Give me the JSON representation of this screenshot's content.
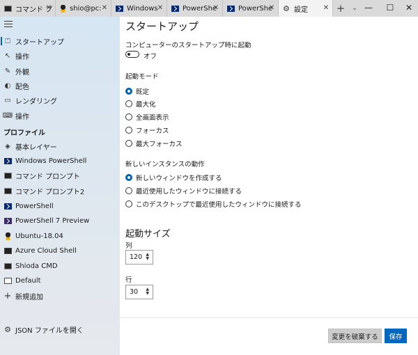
{
  "tabs": [
    {
      "label": "コマンド プ",
      "icon": "cmd-icon"
    },
    {
      "label": "shio@pc:",
      "icon": "linux-penguin-icon"
    },
    {
      "label": "Windows",
      "icon": "powershell-icon"
    },
    {
      "label": "PowerShe",
      "icon": "powershell-icon"
    },
    {
      "label": "PowerShe",
      "icon": "powershell-icon"
    },
    {
      "label": "設定",
      "icon": "gear-icon",
      "active": true
    }
  ],
  "tab_close_glyph": "✕",
  "new_tab_glyph": "+",
  "tab_dropdown_glyph": "⌄",
  "window": {
    "minimize": "—",
    "maximize": "☐",
    "close": "✕"
  },
  "sidebar": {
    "top_items": [
      {
        "label": "スタートアップ",
        "icon": "startup-icon",
        "selected": true
      },
      {
        "label": "操作",
        "icon": "interaction-icon"
      },
      {
        "label": "外観",
        "icon": "appearance-icon"
      },
      {
        "label": "配色",
        "icon": "color-palette-icon"
      },
      {
        "label": "レンダリング",
        "icon": "rendering-icon"
      },
      {
        "label": "操作",
        "icon": "actions-icon"
      }
    ],
    "profiles_header": "プロファイル",
    "profiles": [
      {
        "label": "基本レイヤー",
        "icon": "layers-icon"
      },
      {
        "label": "Windows PowerShell",
        "icon": "powershell-icon"
      },
      {
        "label": "コマンド プロンプト",
        "icon": "cmd-icon"
      },
      {
        "label": "コマンド プロンプト2",
        "icon": "cmd-icon"
      },
      {
        "label": "PowerShell",
        "icon": "powershell-icon"
      },
      {
        "label": "PowerShell 7 Preview",
        "icon": "powershell-preview-icon"
      },
      {
        "label": "Ubuntu-18.04",
        "icon": "linux-penguin-icon"
      },
      {
        "label": "Azure Cloud Shell",
        "icon": "azure-icon"
      },
      {
        "label": "Shioda CMD",
        "icon": "cmd-icon"
      },
      {
        "label": "Default",
        "icon": "terminal-icon"
      },
      {
        "label": "新規追加",
        "icon": "add-icon"
      }
    ],
    "open_json": "JSON ファイルを開く"
  },
  "main": {
    "title": "スタートアップ",
    "launch_on_startup_label": "コンピューターのスタートアップ時に起動",
    "launch_on_startup_state": "オフ",
    "launch_mode_label": "起動モード",
    "launch_modes": [
      "既定",
      "最大化",
      "全画面表示",
      "フォーカス",
      "最大フォーカス"
    ],
    "launch_mode_selected": 0,
    "new_instance_label": "新しいインスタンスの動作",
    "new_instance_options": [
      "新しいウィンドウを作成する",
      "最近使用したウィンドウに接続する",
      "このデスクトップで最近使用したウィンドウに接続する"
    ],
    "new_instance_selected": 0,
    "launch_size_title": "起動サイズ",
    "columns_label": "列",
    "columns_value": "120",
    "rows_label": "行",
    "rows_value": "30",
    "discard_button": "変更を破棄する",
    "save_button": "保存"
  }
}
